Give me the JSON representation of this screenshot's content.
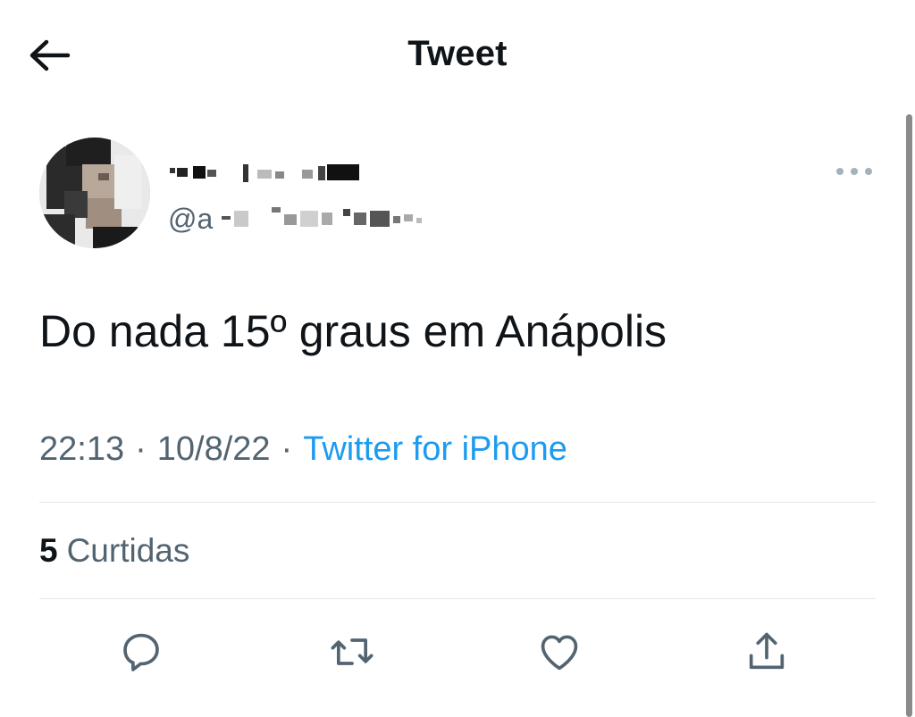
{
  "header": {
    "title": "Tweet",
    "back_icon": "arrow-left-icon"
  },
  "author": {
    "display_name": "",
    "handle": "@a",
    "avatar_icon": "avatar-blurred",
    "more_icon": "more-horizontal-icon"
  },
  "tweet": {
    "text": "Do nada 15º graus em Anápolis",
    "time": "22:13",
    "date": "10/8/22",
    "separator": "·",
    "source": "Twitter for iPhone"
  },
  "stats": {
    "likes_count": "5",
    "likes_label": "Curtidas"
  },
  "actions": [
    {
      "name": "reply",
      "icon": "reply-icon"
    },
    {
      "name": "retweet",
      "icon": "retweet-icon"
    },
    {
      "name": "like",
      "icon": "heart-icon"
    },
    {
      "name": "share",
      "icon": "share-icon"
    }
  ],
  "colors": {
    "text_primary": "#0f1419",
    "text_secondary": "#536471",
    "accent": "#1d9bf0",
    "divider": "#e6e6e6"
  }
}
